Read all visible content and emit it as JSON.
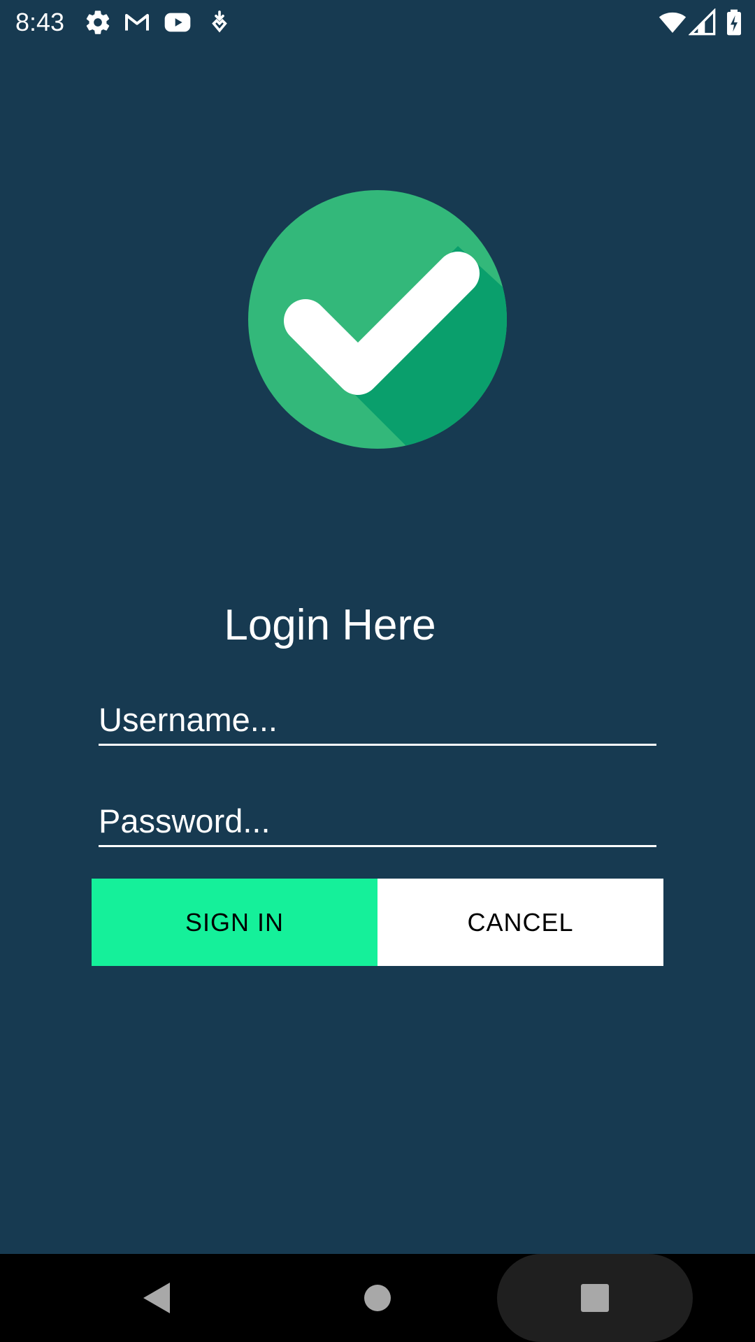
{
  "status_bar": {
    "time": "8:43",
    "icons": [
      "gear-icon",
      "gmail-icon",
      "youtube-icon",
      "download-icon",
      "wifi-icon",
      "signal-icon",
      "battery-charging-icon"
    ]
  },
  "login": {
    "title": "Login Here",
    "username_placeholder": "Username...",
    "password_placeholder": "Password...",
    "username_value": "",
    "password_value": "",
    "sign_in_label": "SIGN IN",
    "cancel_label": "CANCEL"
  },
  "colors": {
    "background": "#173a51",
    "sign_in_button": "#15f09a",
    "cancel_button": "#ffffff",
    "logo_green": "#33b87a",
    "logo_shadow": "#0a9f6c"
  },
  "nav_bar": {
    "buttons": [
      "back-icon",
      "home-icon",
      "recents-icon"
    ]
  }
}
